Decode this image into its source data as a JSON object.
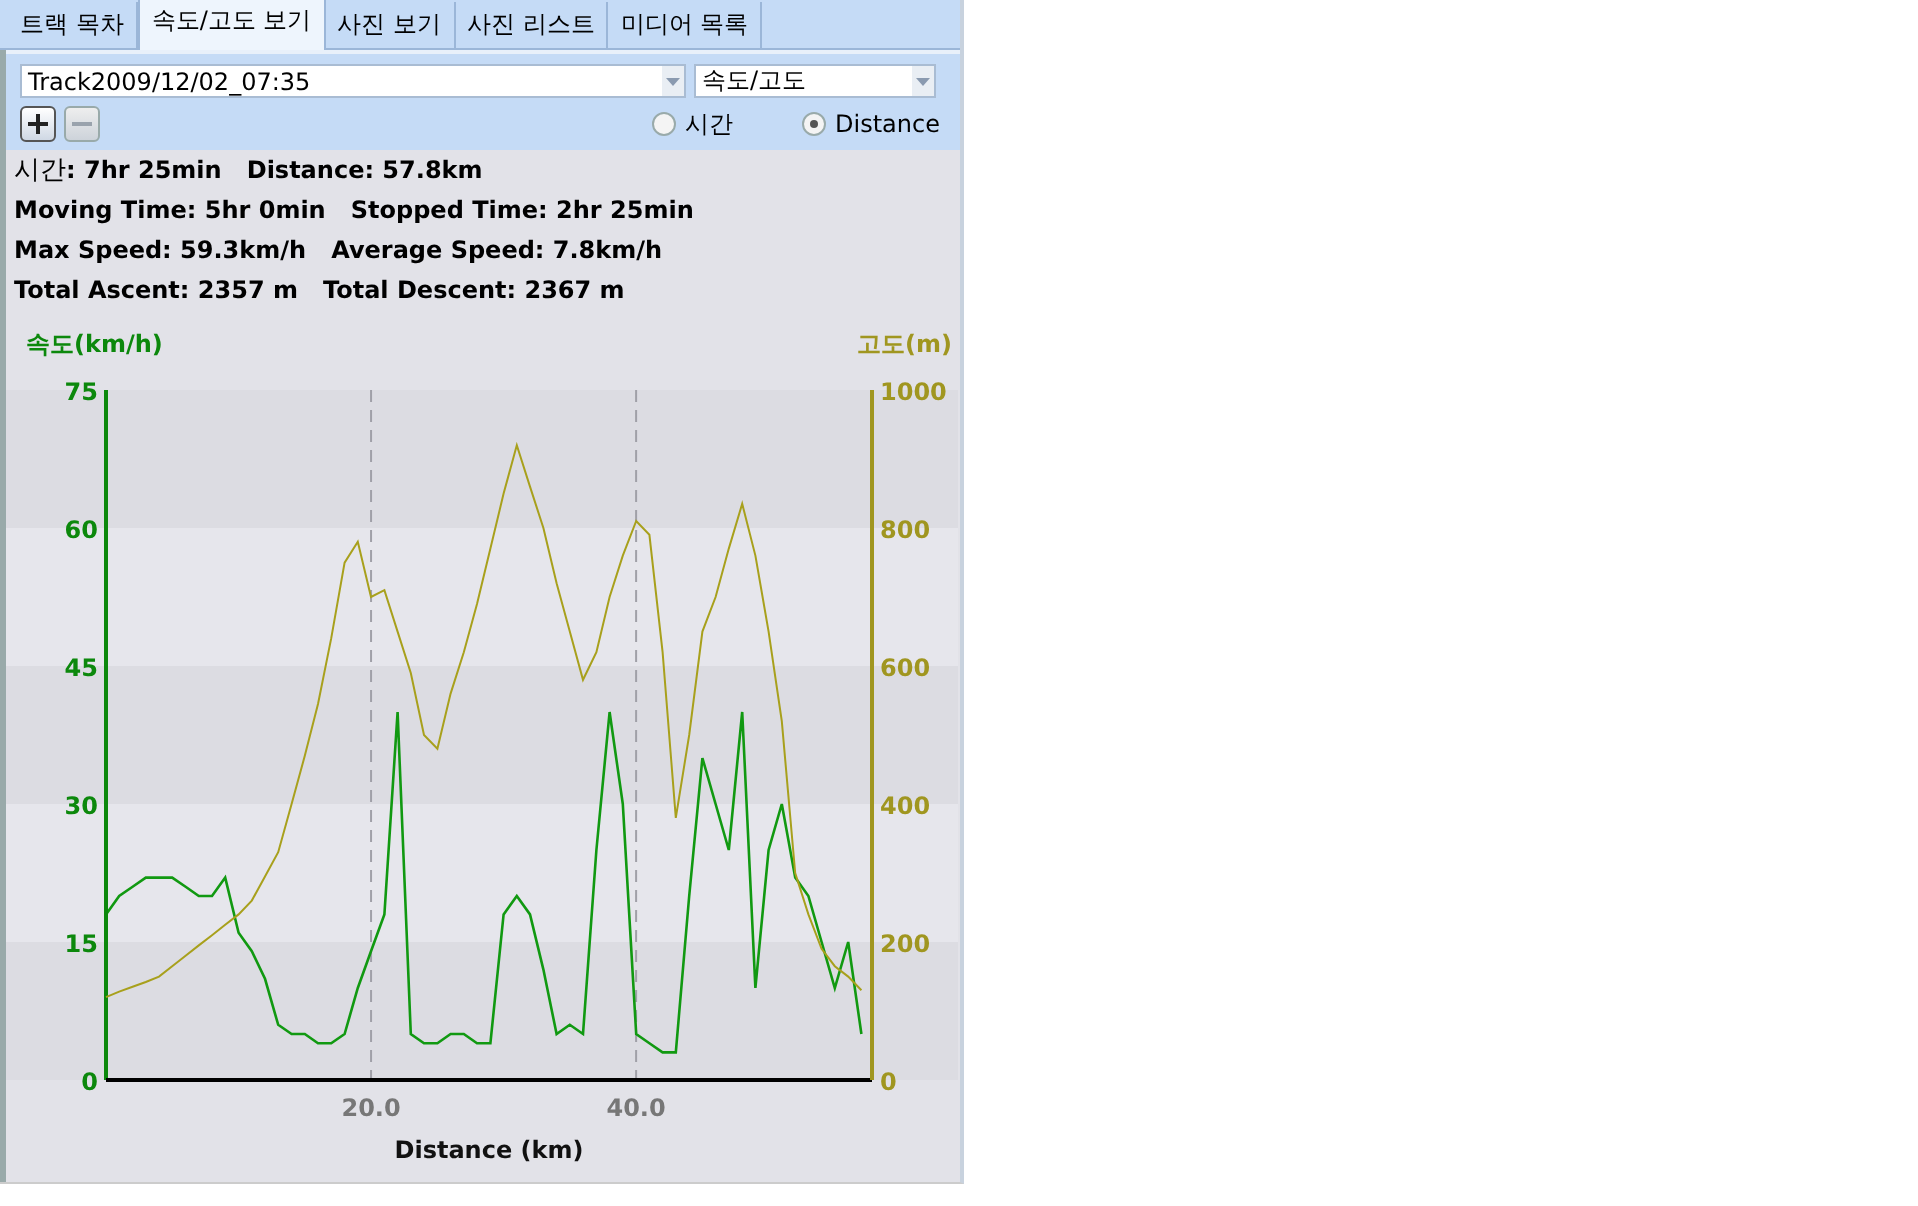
{
  "tabs": [
    {
      "label": "트랙 목차",
      "selected": false
    },
    {
      "label": "속도/고도 보기",
      "selected": true
    },
    {
      "label": "사진 보기",
      "selected": false
    },
    {
      "label": "사진 리스트",
      "selected": false
    },
    {
      "label": "미디어 목록",
      "selected": false
    }
  ],
  "toolbar": {
    "track_select": {
      "value": "Track2009/12/02_07:35"
    },
    "mode_select": {
      "value": "속도/고도"
    },
    "zoom_buttons": [
      {
        "kind": "plus",
        "disabled": false
      },
      {
        "kind": "minus",
        "disabled": true
      }
    ],
    "axis_radios": [
      {
        "label": "시간",
        "selected": false
      },
      {
        "label": "Distance",
        "selected": true
      }
    ]
  },
  "stats": [
    {
      "kind": "mixed",
      "text": "시간**: 7hr 25min   Distance: 57.8km**"
    },
    {
      "kind": "bold",
      "text": "Moving Time: 5hr 0min   Stopped Time: 2hr 25min"
    },
    {
      "kind": "bold",
      "text": "Max Speed: 59.3km/h   Average Speed: 7.8km/h"
    },
    {
      "kind": "bold",
      "text": "Total Ascent: 2357 m   Total Descent: 2367 m"
    }
  ],
  "chart": {
    "speed": {
      "chart_data": {
        "type": "line",
        "xlabel": "Distance (km)",
        "ylabel": "속도(km/h)",
        "x": [
          0,
          1,
          2,
          3,
          4,
          5,
          6,
          7,
          8,
          9,
          10,
          11,
          12,
          13,
          14,
          15,
          16,
          17,
          18,
          19,
          20,
          21,
          22,
          23,
          24,
          25,
          26,
          27,
          28,
          29,
          30,
          31,
          32,
          33,
          34,
          35,
          36,
          37,
          38,
          39,
          40,
          41,
          42,
          43,
          44,
          45,
          46,
          47,
          48,
          49,
          50,
          51,
          52,
          53,
          54,
          55,
          56,
          57
        ],
        "series": [
          {
            "color": "#119911",
            "values": [
              18,
              20,
              21,
              22,
              22,
              22,
              21,
              20,
              20,
              22,
              16,
              14,
              11,
              6,
              5,
              5,
              4,
              4,
              5,
              10,
              14,
              18,
              40,
              5,
              4,
              4,
              5,
              5,
              4,
              4,
              18,
              20,
              18,
              12,
              5,
              6,
              5,
              25,
              40,
              30,
              5,
              4,
              3,
              3,
              20,
              35,
              30,
              25,
              40,
              10,
              25,
              30,
              22,
              20,
              15,
              10,
              15,
              5
            ]
          }
        ],
        "xlim": [
          0,
          57.8
        ],
        "ylim": [
          0,
          75
        ],
        "xticks": [
          {
            "value": 20,
            "label": "20.0"
          },
          {
            "value": 40,
            "label": "40.0"
          }
        ],
        "yticks": [
          0,
          15,
          30,
          45,
          60,
          75
        ]
      }
    },
    "altitude": {
      "chart_data": {
        "type": "line",
        "ylabel": "고도(m)",
        "x": [
          0,
          1,
          2,
          3,
          4,
          5,
          6,
          7,
          8,
          9,
          10,
          11,
          12,
          13,
          14,
          15,
          16,
          17,
          18,
          19,
          20,
          21,
          22,
          23,
          24,
          25,
          26,
          27,
          28,
          29,
          30,
          31,
          32,
          33,
          34,
          35,
          36,
          37,
          38,
          39,
          40,
          41,
          42,
          43,
          44,
          45,
          46,
          47,
          48,
          49,
          50,
          51,
          52,
          53,
          54,
          55,
          56,
          57
        ],
        "series": [
          {
            "color": "#a8a01c",
            "values": [
              120,
              128,
              135,
              142,
              150,
              165,
              180,
              195,
              210,
              225,
              240,
              260,
              295,
              330,
              400,
              470,
              545,
              640,
              750,
              780,
              700,
              710,
              650,
              590,
              500,
              480,
              560,
              620,
              690,
              770,
              850,
              920,
              860,
              800,
              720,
              650,
              580,
              620,
              700,
              760,
              810,
              790,
              620,
              380,
              500,
              650,
              700,
              770,
              835,
              760,
              650,
              520,
              300,
              240,
              190,
              165,
              150,
              130
            ]
          }
        ],
        "xlim": [
          0,
          57.8
        ],
        "ylim": [
          0,
          1000
        ],
        "yticks": [
          0,
          200,
          400,
          600,
          800,
          1000
        ]
      }
    }
  }
}
